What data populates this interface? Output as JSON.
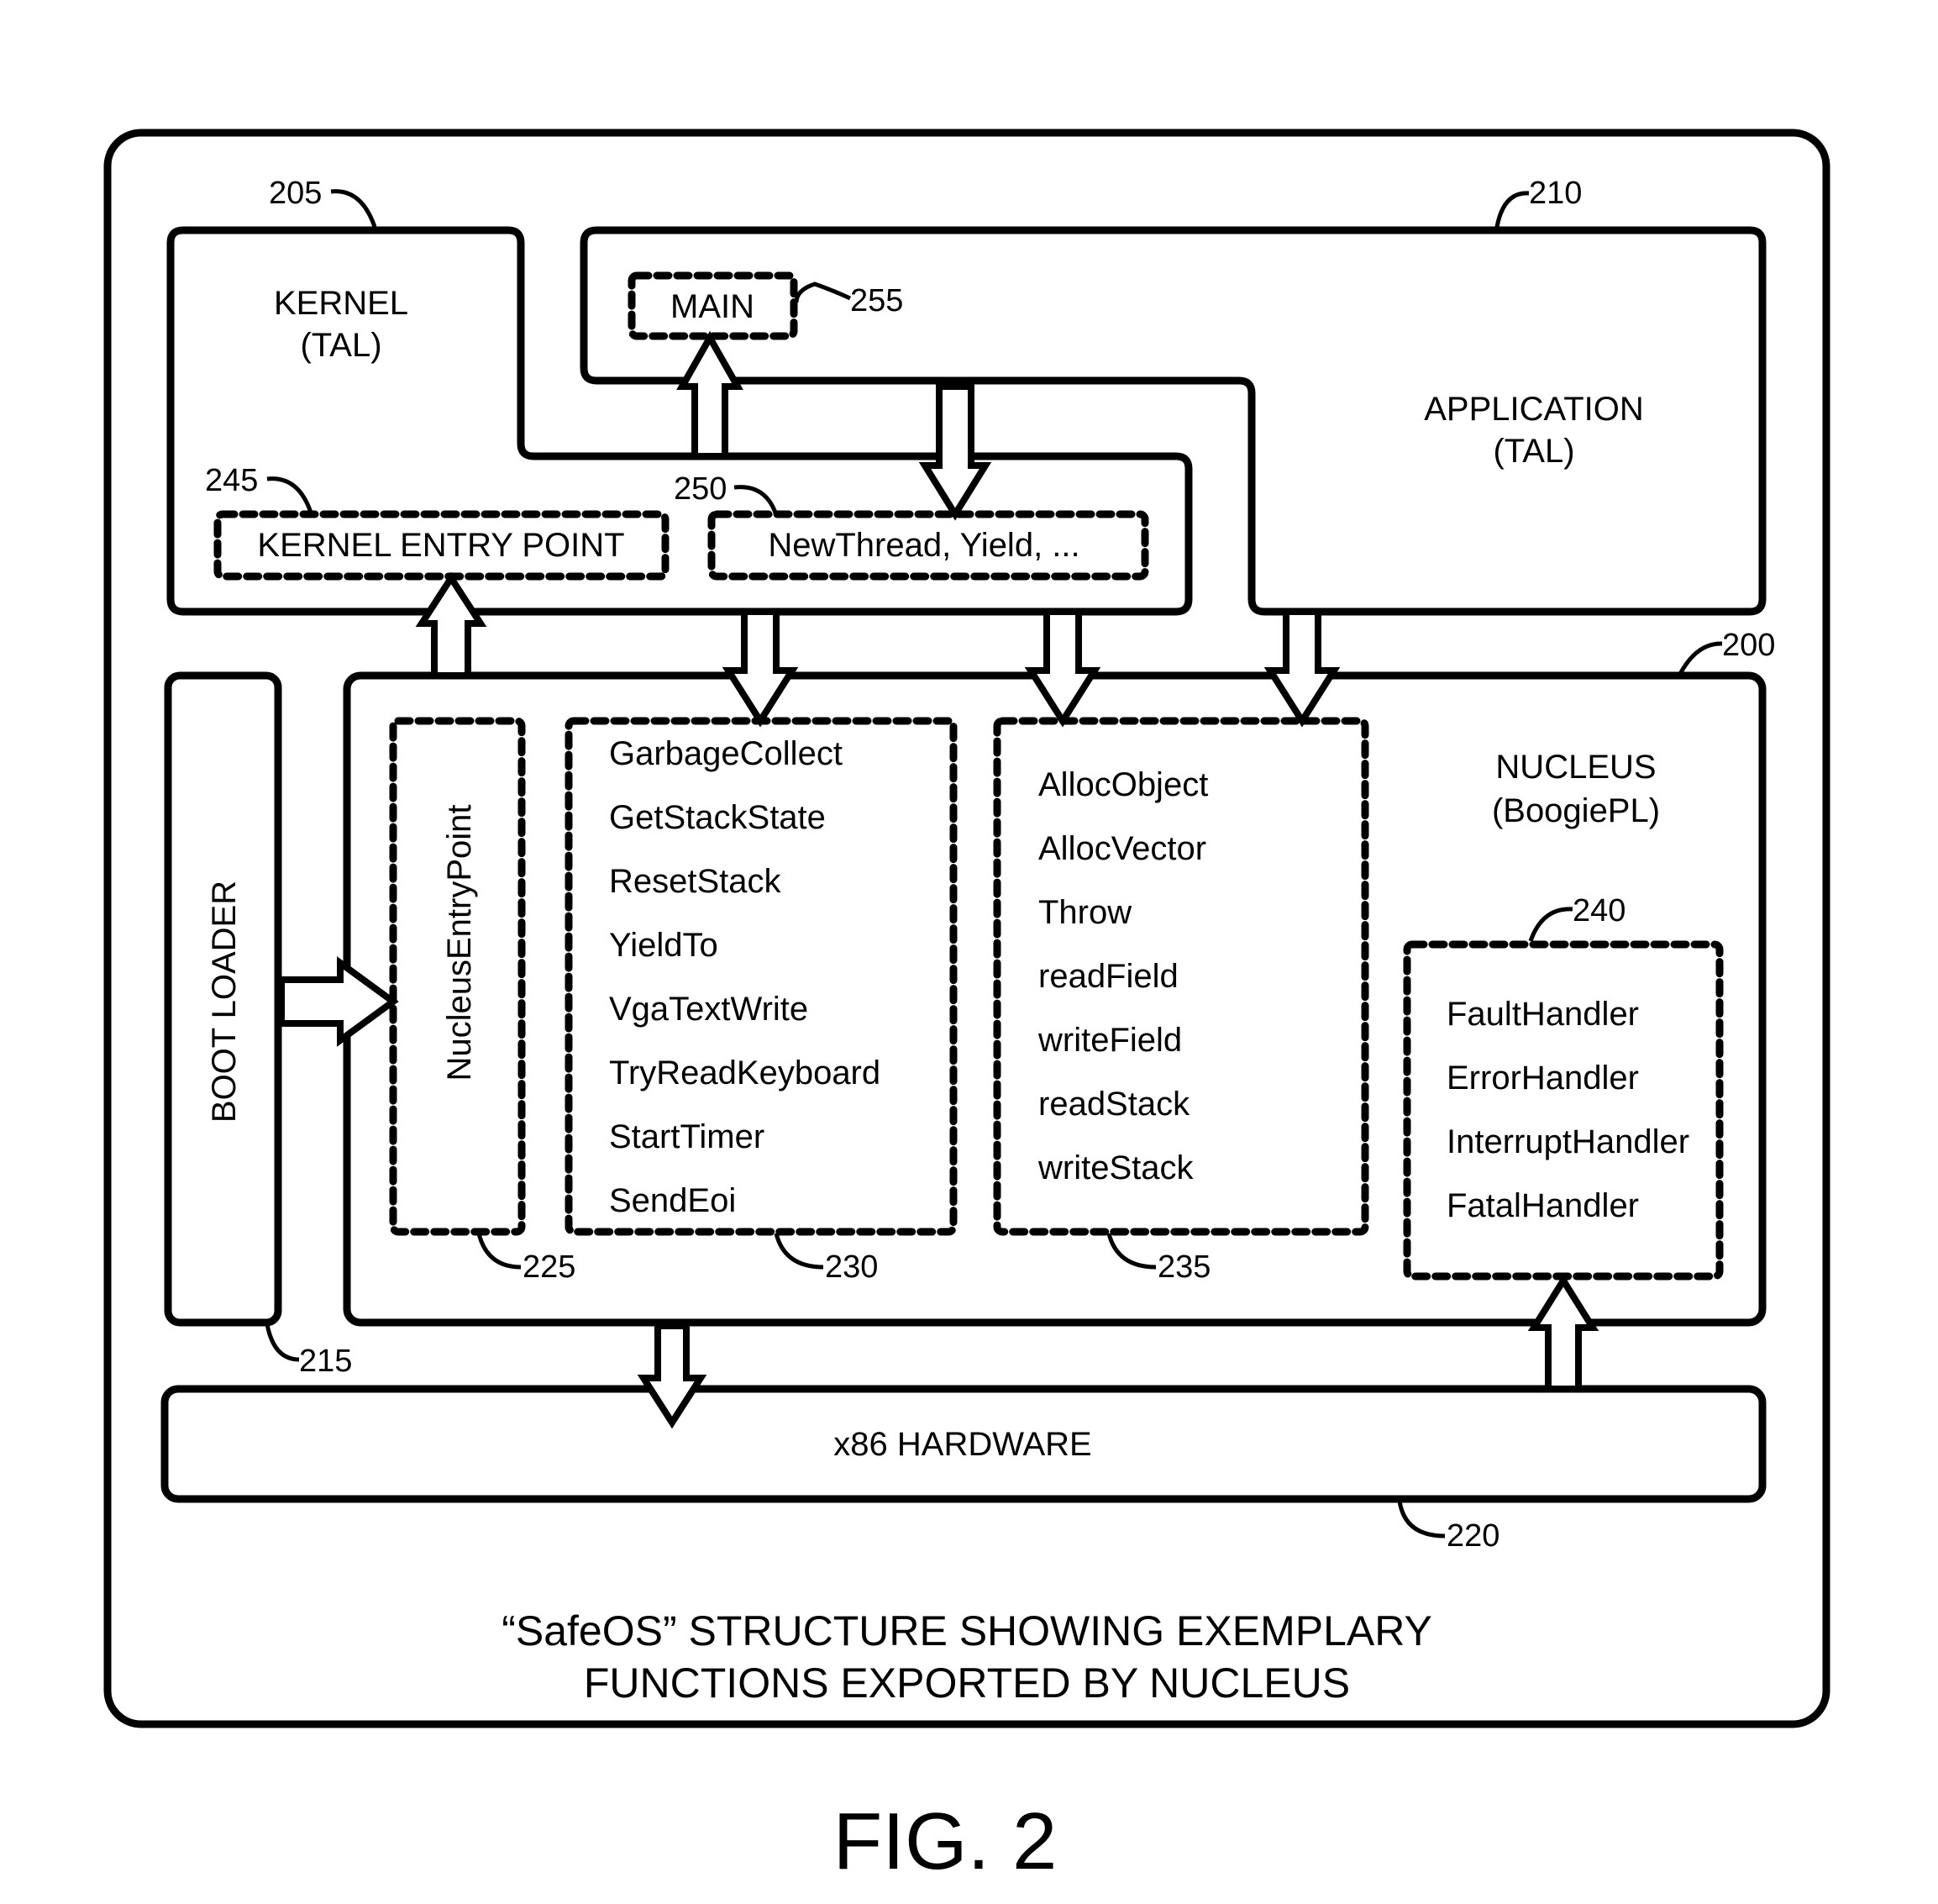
{
  "figure": {
    "caption_line1": "“SafeOS” STRUCTURE SHOWING EXEMPLARY",
    "caption_line2": "FUNCTIONS EXPORTED BY NUCLEUS",
    "figure_label": "FIG. 2"
  },
  "kernel": {
    "ref": "205",
    "title": "KERNEL",
    "subtitle": "(TAL)",
    "entry_point": {
      "ref": "245",
      "label": "KERNEL ENTRY POINT"
    },
    "calls": {
      "ref": "250",
      "label": "NewThread, Yield, ..."
    }
  },
  "application": {
    "ref": "210",
    "title": "APPLICATION",
    "subtitle": "(TAL)",
    "main": {
      "ref": "255",
      "label": "MAIN"
    }
  },
  "nucleus": {
    "ref": "200",
    "title": "NUCLEUS",
    "subtitle": "(BoogiePL)",
    "entry": {
      "ref": "225",
      "label": "NucleusEntryPoint"
    },
    "kernel_functions": {
      "ref": "230",
      "items": [
        "GarbageCollect",
        "GetStackState",
        "ResetStack",
        "YieldTo",
        "VgaTextWrite",
        "TryReadKeyboard",
        "StartTimer",
        "SendEoi"
      ]
    },
    "app_functions": {
      "ref": "235",
      "items": [
        "AllocObject",
        "AllocVector",
        "Throw",
        "readField",
        "writeField",
        "readStack",
        "writeStack"
      ]
    },
    "handlers": {
      "ref": "240",
      "items": [
        "FaultHandler",
        "ErrorHandler",
        "InterruptHandler",
        "FatalHandler"
      ]
    }
  },
  "boot_loader": {
    "ref": "215",
    "label": "BOOT LOADER"
  },
  "hardware": {
    "ref": "220",
    "label": "x86 HARDWARE"
  }
}
